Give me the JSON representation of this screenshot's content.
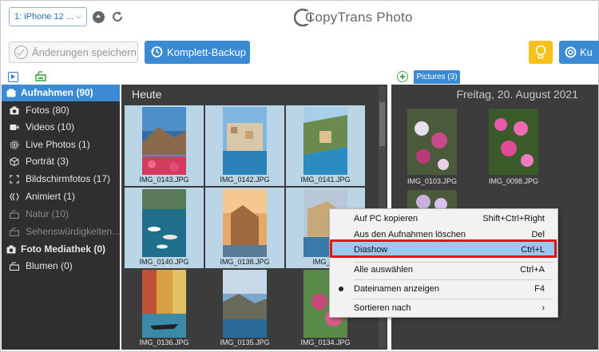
{
  "toolbar": {
    "device": "1: iPhone 12 ...",
    "logo": "CopyTrans Photo",
    "save_label": "Änderungen speichern",
    "backup_label": "Komplett-Backup",
    "support_label": "Ku"
  },
  "strip": {
    "pictures_tab": "Pictures (3)"
  },
  "sidebar": {
    "items": [
      {
        "label": "Aufnahmen (90)",
        "icon": "camera-roll-icon"
      },
      {
        "label": "Fotos (80)",
        "icon": "camera-icon"
      },
      {
        "label": "Videos (10)",
        "icon": "video-icon"
      },
      {
        "label": "Live Photos (1)",
        "icon": "live-photo-icon"
      },
      {
        "label": "Porträt (3)",
        "icon": "cube-icon"
      },
      {
        "label": "Bildschirmfotos (17)",
        "icon": "screenshot-icon"
      },
      {
        "label": "Animiert (1)",
        "icon": "animated-icon"
      },
      {
        "label": "Natur (10)",
        "icon": "album-icon"
      },
      {
        "label": "Sehenswürdigkeiten...",
        "icon": "album-icon"
      },
      {
        "label": "Foto Mediathek (0)",
        "icon": "camera-icon"
      },
      {
        "label": "Blumen (0)",
        "icon": "album-icon"
      }
    ]
  },
  "main": {
    "title": "Heute",
    "tiles": [
      "IMG_0143.JPG",
      "IMG_0142.JPG",
      "IMG_0141.JPG",
      "IMG_0140.JPG",
      "IMG_0138.JPG",
      "IMG_01",
      "IMG_0136.JPG",
      "IMG_0135.JPG",
      "IMG_0134.JPG"
    ]
  },
  "right": {
    "title": "Freitag, 20. August 2021",
    "tiles": [
      "IMG_0103.JPG",
      "IMG_0098.JPG"
    ]
  },
  "context_menu": {
    "items": [
      {
        "label": "Auf PC kopieren",
        "shortcut": "Shift+Ctrl+Right"
      },
      {
        "label": "Aus den Aufnahmen löschen",
        "shortcut": "Del"
      },
      {
        "label": "Diashow",
        "shortcut": "Ctrl+L"
      },
      {
        "label": "Alle auswählen",
        "shortcut": "Ctrl+A"
      },
      {
        "label": "Dateinamen anzeigen",
        "shortcut": "F4"
      },
      {
        "label": "Sortieren nach",
        "shortcut": "›"
      }
    ]
  },
  "colors": {
    "accent": "#3a8bd4",
    "highlight_border": "#e3151b",
    "menu_highlight": "#9ac8ef",
    "dark_bg": "#3c3c3c"
  }
}
